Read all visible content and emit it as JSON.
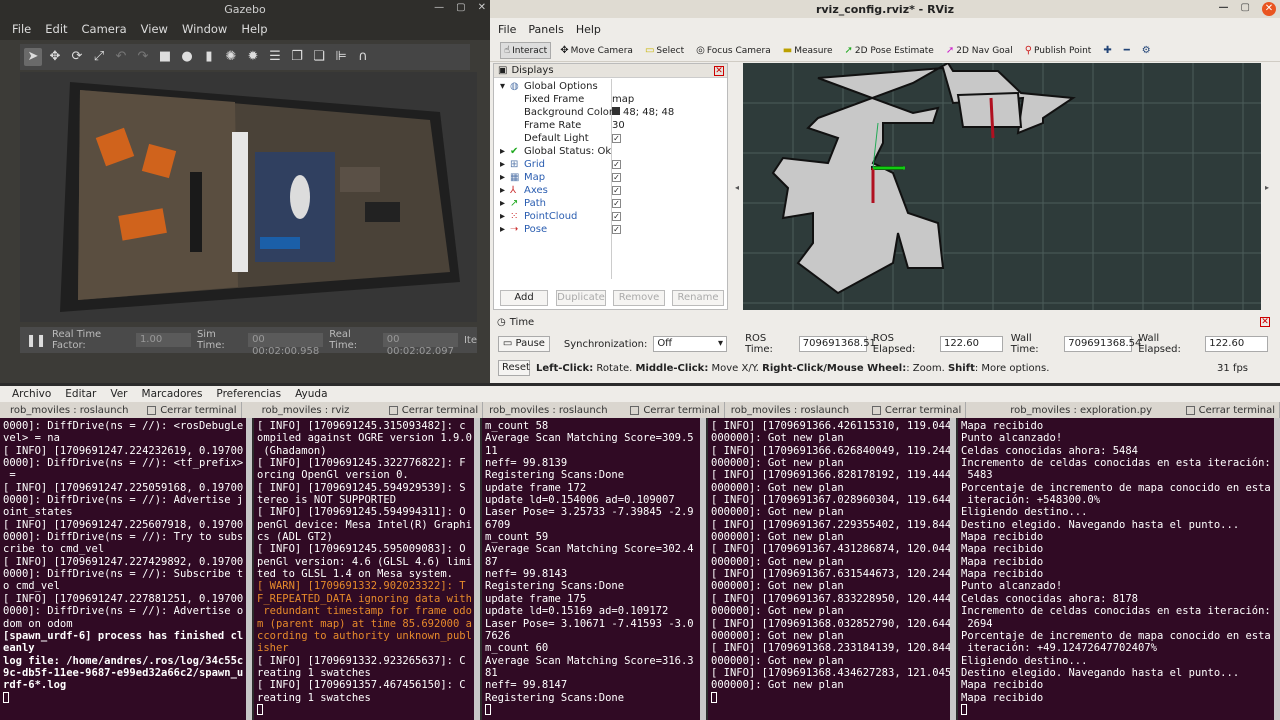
{
  "gazebo": {
    "title": "Gazebo",
    "menu": [
      "File",
      "Edit",
      "Camera",
      "View",
      "Window",
      "Help"
    ],
    "bottom": {
      "rtf_label": "Real Time Factor:",
      "rtf_value": "1.00",
      "sim_label": "Sim Time:",
      "sim_value": "00 00:02:00.958",
      "real_label": "Real Time:",
      "real_value": "00 00:02:02.097",
      "iter_value": "Ite"
    }
  },
  "rviz": {
    "title": "rviz_config.rviz* - RViz",
    "menu": [
      "File",
      "Panels",
      "Help"
    ],
    "toolbar": [
      "Interact",
      "Move Camera",
      "Select",
      "Focus Camera",
      "Measure",
      "2D Pose Estimate",
      "2D Nav Goal",
      "Publish Point"
    ],
    "displays": {
      "header": "Displays",
      "global_options": "Global Options",
      "fixed_frame_k": "Fixed Frame",
      "fixed_frame_v": "map",
      "bg_color_k": "Background Color",
      "bg_color_v": "48; 48; 48",
      "frame_rate_k": "Frame Rate",
      "frame_rate_v": "30",
      "default_light_k": "Default Light",
      "global_status": "Global Status: Ok",
      "items": [
        "Grid",
        "Map",
        "Axes",
        "Path",
        "PointCloud",
        "Pose"
      ]
    },
    "buttons": {
      "add": "Add",
      "duplicate": "Duplicate",
      "remove": "Remove",
      "rename": "Rename"
    },
    "time": {
      "header": "Time",
      "pause": "Pause",
      "sync_label": "Synchronization:",
      "sync_value": "Off",
      "ros_time_label": "ROS Time:",
      "ros_time_value": "709691368.51",
      "ros_elapsed_label": "ROS Elapsed:",
      "ros_elapsed_value": "122.60",
      "wall_time_label": "Wall Time:",
      "wall_time_value": "709691368.54",
      "wall_elapsed_label": "Wall Elapsed:",
      "wall_elapsed_value": "122.60"
    },
    "reset": "Reset",
    "hint_b1": "Left-Click:",
    "hint_t1": " Rotate. ",
    "hint_b2": "Middle-Click:",
    "hint_t2": " Move X/Y. ",
    "hint_b3": "Right-Click/Mouse Wheel:",
    "hint_t3": ": Zoom. ",
    "hint_b4": "Shift",
    "hint_t4": ": More options.",
    "fps": "31 fps"
  },
  "terminal": {
    "menu": [
      "Archivo",
      "Editar",
      "Ver",
      "Marcadores",
      "Preferencias",
      "Ayuda"
    ],
    "close_label": "Cerrar terminal",
    "tabs": [
      "rob_moviles : roslaunch",
      "rob_moviles : rviz",
      "rob_moviles : roslaunch",
      "rob_moviles : roslaunch",
      "rob_moviles : exploration.py"
    ],
    "pane1": [
      "0000]: DiffDrive(ns = //): <rosDebugLe",
      "vel> = na",
      "[ INFO] [1709691247.224232619, 0.19700",
      "0000]: DiffDrive(ns = //): <tf_prefix>",
      " =",
      "[ INFO] [1709691247.225059168, 0.19700",
      "0000]: DiffDrive(ns = //): Advertise j",
      "oint_states",
      "[ INFO] [1709691247.225607918, 0.19700",
      "0000]: DiffDrive(ns = //): Try to subs",
      "cribe to cmd_vel",
      "[ INFO] [1709691247.227429892, 0.19700",
      "0000]: DiffDrive(ns = //): Subscribe t",
      "o cmd_vel",
      "[ INFO] [1709691247.227881251, 0.19700",
      "0000]: DiffDrive(ns = //): Advertise o",
      "dom on odom"
    ],
    "pane1_bold": [
      "[spawn_urdf-6] process has finished cl",
      "eanly",
      "log file: /home/andres/.ros/log/34c55c",
      "9c-db5f-11ee-9687-e99ed32a66c2/spawn_u",
      "rdf-6*.log"
    ],
    "pane2": [
      "[ INFO] [1709691245.315093482]: c",
      "ompiled against OGRE version 1.9.0",
      " (Ghadamon)",
      "[ INFO] [1709691245.322776822]: F",
      "orcing OpenGl version 0.",
      "[ INFO] [1709691245.594929539]: S",
      "tereo is NOT SUPPORTED",
      "[ INFO] [1709691245.594994311]: O",
      "penGl device: Mesa Intel(R) Graphi",
      "cs (ADL GT2)",
      "[ INFO] [1709691245.595009083]: O",
      "penGl version: 4.6 (GLSL 4.6) limi",
      "ted to GLSL 1.4 on Mesa system."
    ],
    "pane2_warn": [
      "[ WARN] [1709691332.902023322]: T",
      "F_REPEATED_DATA ignoring data with",
      " redundant timestamp for frame odo",
      "m (parent map) at time 85.692000 a",
      "ccording to authority unknown_publ",
      "isher"
    ],
    "pane2_end": [
      "[ INFO] [1709691332.923265637]: C",
      "reating 1 swatches",
      "[ INFO] [1709691357.467456150]: C",
      "reating 1 swatches"
    ],
    "pane3": [
      "m_count 58",
      "Average Scan Matching Score=309.5",
      "11",
      "neff= 99.8139",
      "Registering Scans:Done",
      "update frame 172",
      "update ld=0.154006 ad=0.109007",
      "Laser Pose= 3.25733 -7.39845 -2.9",
      "6709",
      "m_count 59",
      "Average Scan Matching Score=302.4",
      "87",
      "neff= 99.8143",
      "Registering Scans:Done",
      "update frame 175",
      "update ld=0.15169 ad=0.109172",
      "Laser Pose= 3.10671 -7.41593 -3.0",
      "7626",
      "m_count 60",
      "Average Scan Matching Score=316.3",
      "81",
      "neff= 99.8147",
      "Registering Scans:Done"
    ],
    "pane4": [
      "[ INFO] [1709691366.426115310, 119.044",
      "000000]: Got new plan",
      "[ INFO] [1709691366.626840049, 119.244",
      "000000]: Got new plan",
      "[ INFO] [1709691366.828178192, 119.444",
      "000000]: Got new plan",
      "[ INFO] [1709691367.028960304, 119.644",
      "000000]: Got new plan",
      "[ INFO] [1709691367.229355402, 119.844",
      "000000]: Got new plan",
      "[ INFO] [1709691367.431286874, 120.044",
      "000000]: Got new plan",
      "[ INFO] [1709691367.631544673, 120.244",
      "000000]: Got new plan",
      "[ INFO] [1709691367.833228950, 120.444",
      "000000]: Got new plan",
      "[ INFO] [1709691368.032852790, 120.644",
      "000000]: Got new plan",
      "[ INFO] [1709691368.233184139, 120.844",
      "000000]: Got new plan",
      "[ INFO] [1709691368.434627283, 121.045",
      "000000]: Got new plan"
    ],
    "pane5": [
      "Mapa recibido",
      "Punto alcanzado!",
      "Celdas conocidas ahora: 5484",
      "Incremento de celdas conocidas en esta iteración:",
      " 5483",
      "Porcentaje de incremento de mapa conocido en esta",
      " iteración: +548300.0%",
      "Eligiendo destino...",
      "Destino elegido. Navegando hasta el punto...",
      "Mapa recibido",
      "Mapa recibido",
      "Mapa recibido",
      "Mapa recibido",
      "Punto alcanzado!",
      "Celdas conocidas ahora: 8178",
      "Incremento de celdas conocidas en esta iteración:",
      " 2694",
      "Porcentaje de incremento de mapa conocido en esta",
      " iteración: +49.12472647702407%",
      "Eligiendo destino...",
      "Destino elegido. Navegando hasta el punto...",
      "Mapa recibido",
      "Mapa recibido"
    ]
  }
}
